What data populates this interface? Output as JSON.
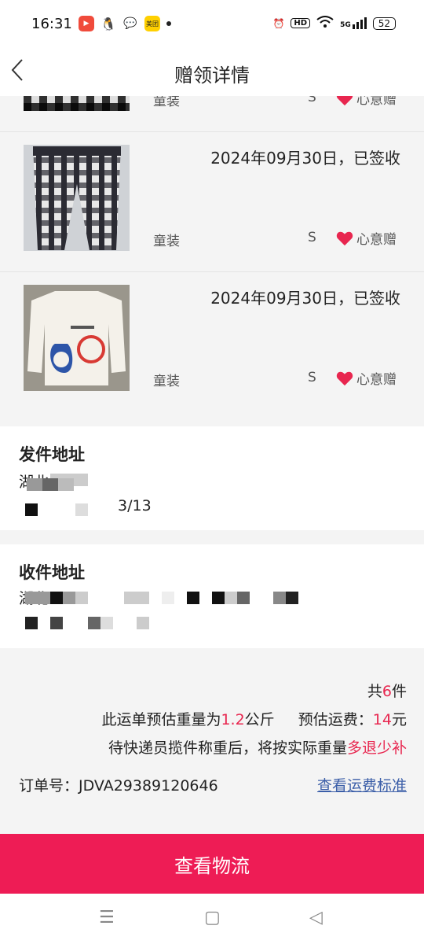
{
  "status_bar": {
    "time": "16:31",
    "meituan_label": "美团",
    "hd_label": "HD",
    "network_label": "5G",
    "battery": "52"
  },
  "nav": {
    "title": "赠领详情"
  },
  "items": [
    {
      "category": "童装",
      "size": "S",
      "tag": "心意赠"
    },
    {
      "date": "2024年09月30日，已签收",
      "category": "童装",
      "size": "S",
      "tag": "心意赠"
    },
    {
      "date": "2024年09月30日，已签收",
      "category": "童装",
      "size": "S",
      "tag": "心意赠"
    }
  ],
  "sender": {
    "label": "发件地址",
    "line1": "湖北",
    "line2": "3/13"
  },
  "receiver": {
    "label": "收件地址",
    "line1": "湖北",
    "line2": ""
  },
  "summary": {
    "count_prefix": "共",
    "count": "6",
    "count_suffix": "件",
    "weight_prefix": "此运单预估重量为",
    "weight": "1.2",
    "weight_unit": "公斤",
    "fee_prefix": "预估运费：",
    "fee": "14",
    "fee_unit": "元",
    "note_prefix": "待快递员揽件称重后，将按实际重量",
    "note_highlight": "多退少补",
    "order_label": "订单号：",
    "order_no": "JDVA29389120646",
    "fee_standard_link": "查看运费标准"
  },
  "cta": {
    "label": "查看物流"
  },
  "colors": {
    "accent": "#ee1c55",
    "link": "#3b5ea8",
    "highlight": "#e8264f"
  }
}
